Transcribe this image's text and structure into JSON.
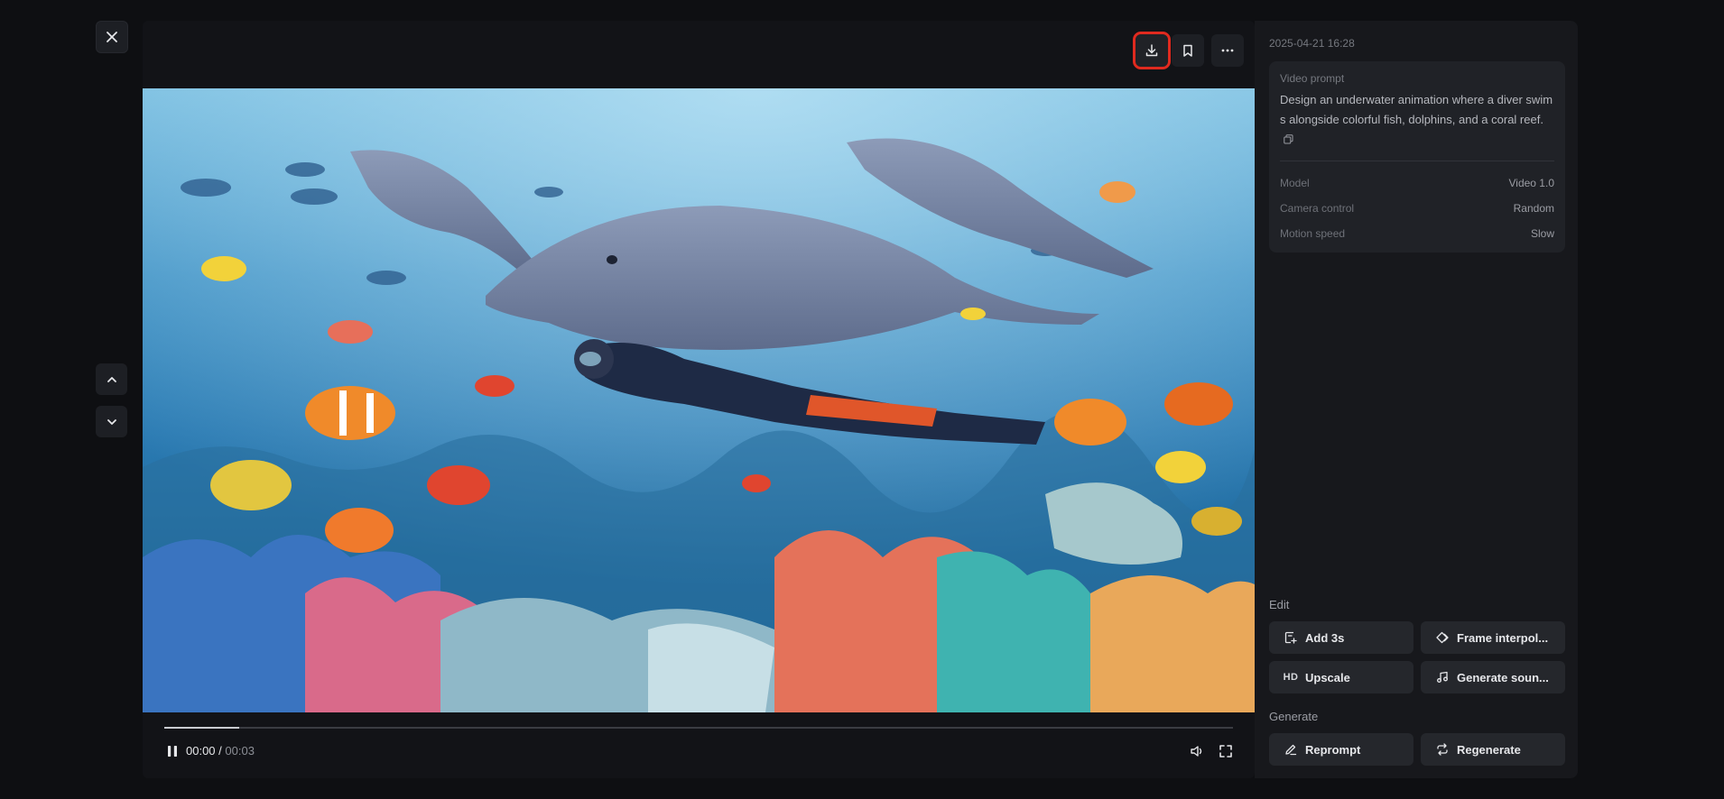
{
  "nav": {
    "close_icon": "close-icon",
    "prev_icon": "chevron-up-icon",
    "next_icon": "chevron-down-icon"
  },
  "toolbar": {
    "download_icon": "download-icon",
    "bookmark_icon": "bookmark-icon",
    "more_icon": "more-horizontal-icon",
    "highlight_color": "#e02a1f"
  },
  "player": {
    "time_current": "00:00",
    "time_separator": " / ",
    "time_total": "00:03",
    "progress_fraction": 0.07,
    "play_state_icon": "pause-icon",
    "volume_icon": "volume-icon",
    "fullscreen_icon": "fullscreen-icon"
  },
  "details": {
    "timestamp": "2025-04-21 16:28",
    "prompt_label": "Video prompt",
    "prompt_text": "Design an underwater animation where a diver swims alongside colorful fish, dolphins, and a coral reef.",
    "meta": [
      {
        "label": "Model",
        "value": "Video 1.0"
      },
      {
        "label": "Camera control",
        "value": "Random"
      },
      {
        "label": "Motion speed",
        "value": "Slow"
      }
    ]
  },
  "edit": {
    "section_label": "Edit",
    "buttons": [
      {
        "label": "Add 3s",
        "icon": "add-time-icon"
      },
      {
        "label": "Frame interpol...",
        "icon": "frame-interpolation-icon"
      },
      {
        "label": "Upscale",
        "icon": "hd-icon"
      },
      {
        "label": "Generate soun...",
        "icon": "music-note-icon"
      }
    ]
  },
  "generate": {
    "section_label": "Generate",
    "buttons": [
      {
        "label": "Reprompt",
        "icon": "pencil-icon"
      },
      {
        "label": "Regenerate",
        "icon": "repeat-icon"
      }
    ]
  }
}
